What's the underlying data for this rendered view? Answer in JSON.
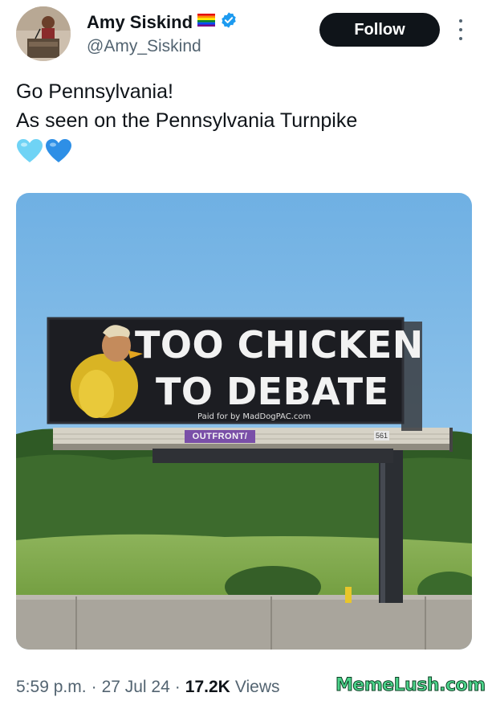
{
  "author": {
    "display_name": "Amy Siskind",
    "handle": "@Amy_Siskind",
    "follow_label": "Follow",
    "icons": [
      "rainbow-flag-icon",
      "verified-badge-icon",
      "more-options-icon"
    ]
  },
  "tweet": {
    "line1": "Go Pennsylvania!",
    "line2": "As seen on the Pennsylvania Turnpike",
    "emoji": [
      "light-blue-heart-icon",
      "blue-heart-icon"
    ]
  },
  "media": {
    "billboard_line1": "TOO CHICKEN",
    "billboard_line2": "TO DEBATE",
    "paid_for": "Paid for by MadDogPAC.com",
    "brand": "OUTFRONT/",
    "panel_number": "561"
  },
  "meta": {
    "time": "5:59 p.m.",
    "sep1": "·",
    "date": "27 Jul 24",
    "sep2": "·",
    "views_count": "17.2K",
    "views_label": "Views"
  },
  "watermark": "MemeLush.com",
  "colors": {
    "accent_dark": "#0f1419",
    "secondary_text": "#536471",
    "verified_blue": "#1d9bf0",
    "sky": "#7fb8e6",
    "watermark_green": "#4cd38a"
  }
}
